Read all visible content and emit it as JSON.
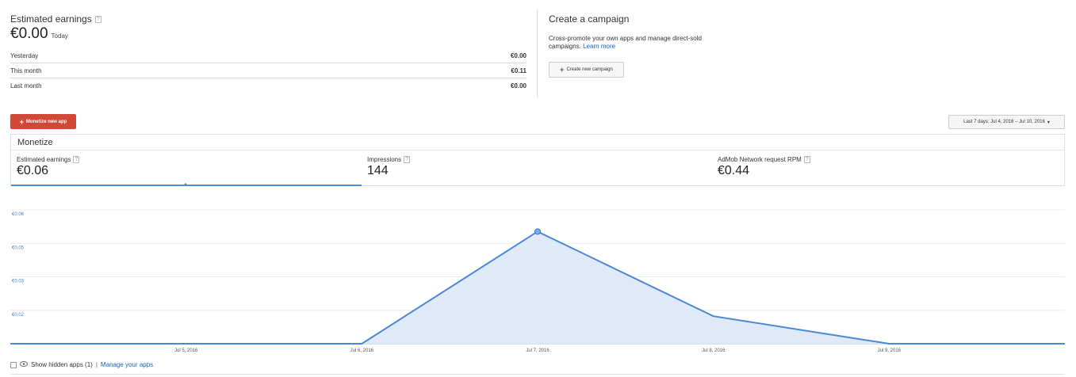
{
  "earnings": {
    "title": "Estimated earnings",
    "amount": "€0.00",
    "period": "Today",
    "rows": [
      {
        "label": "Yesterday",
        "value": "€0.00"
      },
      {
        "label": "This month",
        "value": "€0.11"
      },
      {
        "label": "Last month",
        "value": "€0.00"
      }
    ]
  },
  "campaign": {
    "title": "Create a campaign",
    "description": "Cross-promote your own apps and manage direct-sold campaigns.",
    "learn_more": "Learn more",
    "button_label": "Create new campaign"
  },
  "actions": {
    "monetize_label": "Monetize new app",
    "date_range": "Last 7 days: Jul 4, 2016 – Jul 10, 2016"
  },
  "monetize": {
    "title": "Monetize",
    "metrics": [
      {
        "label": "Estimated earnings",
        "value": "€0.06",
        "active": true
      },
      {
        "label": "Impressions",
        "value": "144",
        "active": false
      },
      {
        "label": "AdMob Network request RPM",
        "value": "€0.44",
        "active": false
      }
    ]
  },
  "chart_data": {
    "type": "area",
    "title": "",
    "xlabel": "",
    "ylabel": "",
    "x": [
      "Jul 4, 2016",
      "Jul 5, 2016",
      "Jul 6, 2016",
      "Jul 7, 2016",
      "Jul 8, 2016",
      "Jul 9, 2016",
      "Jul 10, 2016"
    ],
    "x_tick_labels": [
      "Jul 5, 2016",
      "Jul 6, 2016",
      "Jul 7, 2016",
      "Jul 8, 2016",
      "Jul 9, 2016"
    ],
    "y_tick_labels": [
      "€0.06",
      "€0.05",
      "€0.03",
      "€0.02"
    ],
    "y_tick_values": [
      0.068,
      0.051,
      0.034,
      0.017
    ],
    "ylim": [
      0,
      0.068
    ],
    "series": [
      {
        "values": [
          0,
          0,
          0,
          0.057,
          0.014,
          0,
          0
        ]
      }
    ],
    "highlighted_point": "Jul 7, 2016",
    "grid": true,
    "colors": {
      "line": "#4a87d9",
      "fill": "#dfe9f8"
    }
  },
  "footer": {
    "show_hidden_label": "Show hidden apps (1)",
    "separator": "|",
    "manage_label": "Manage your apps"
  },
  "colors": {
    "accent": "#d14836",
    "link": "#1a62c7"
  }
}
